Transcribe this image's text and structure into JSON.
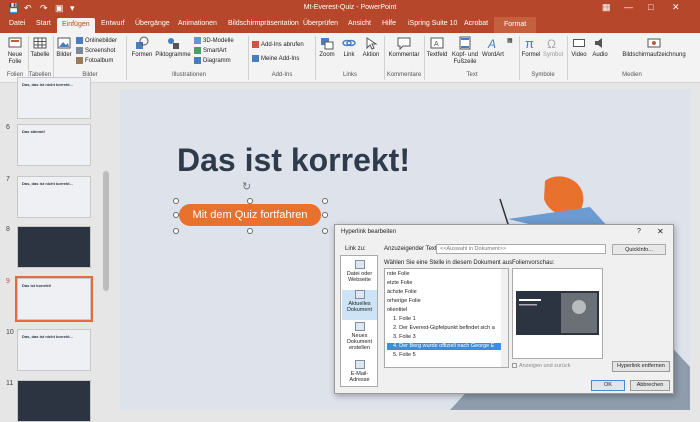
{
  "window": {
    "title": "Mt-Everest-Quiz  -  PowerPoint"
  },
  "quick_access": {
    "save": "save-icon",
    "undo": "undo-icon",
    "redo": "redo-icon",
    "present": "present-icon",
    "customize": "customize-icon"
  },
  "tabs": [
    "Datei",
    "Start",
    "Einfügen",
    "Entwurf",
    "Übergänge",
    "Animationen",
    "Bildschirmpräsentation",
    "Überprüfen",
    "Ansicht",
    "Hilfe",
    "iSpring Suite 10",
    "Acrobat",
    "Format"
  ],
  "active_tab": "Einfügen",
  "ribbon": {
    "folien": {
      "new_slide": "Neue Folie",
      "group": "Folien"
    },
    "tabellen": {
      "table": "Tabelle",
      "group": "Tabellen"
    },
    "bilder": {
      "images": "Bilder",
      "online": "Onlinebilder",
      "screenshot": "Screenshot",
      "album": "Fotoalbum",
      "group": "Bilder"
    },
    "illustrationen": {
      "shapes": "Formen",
      "pictograms": "Piktogramme",
      "models3d": "3D-Modelle",
      "smartart": "SmartArt",
      "diagram": "Diagramm",
      "group": "Illustrationen"
    },
    "addins": {
      "get": "Add-Ins abrufen",
      "mine": "Meine Add-Ins",
      "group": "Add-Ins"
    },
    "links": {
      "zoom": "Zoom",
      "link": "Link",
      "action": "Aktion",
      "group": "Links"
    },
    "kommentare": {
      "comment": "Kommentar",
      "group": "Kommentare"
    },
    "text": {
      "textbox": "Textfeld",
      "header": "Kopf- und Fußzeile",
      "wordart": "WordArt",
      "group": "Text"
    },
    "symbole": {
      "formula": "Formel",
      "symbol": "Symbol",
      "group": "Symbole"
    },
    "medien": {
      "video": "Video",
      "audio": "Audio",
      "record": "Bildschirmaufzeichnung",
      "group": "Medien"
    }
  },
  "thumbnails": [
    {
      "num": "",
      "title": "Das, das ist nicht korrekt...",
      "dark": false
    },
    {
      "num": "6",
      "title": "Das stimmt!",
      "dark": false
    },
    {
      "num": "7",
      "title": "Das, das ist nicht korrekt...",
      "dark": false
    },
    {
      "num": "8",
      "title": "",
      "dark": true
    },
    {
      "num": "9",
      "title": "Das ist korrekt!",
      "dark": false
    },
    {
      "num": "10",
      "title": "Das, das ist nicht korrekt...",
      "dark": false
    },
    {
      "num": "11",
      "title": "",
      "dark": true
    }
  ],
  "slide": {
    "heading": "Das ist korrekt!",
    "button": "Mit dem Quiz fortfahren"
  },
  "dialog": {
    "title": "Hyperlink bearbeiten",
    "help": "?",
    "link_to_label": "Link zu:",
    "display_text_label": "Anzuzeigender Text:",
    "display_text_value": "<<Auswahl in Dokument>>",
    "screentip_button": "QuickInfo...",
    "link_options": [
      "Datei oder Webseite",
      "Aktuelles Dokument",
      "Neues Dokument erstellen",
      "E-Mail-Adresse"
    ],
    "choose_label": "Wählen Sie eine Stelle in diesem Dokument aus:",
    "doc_items": [
      "rste Folie",
      "etzte Folie",
      "ächste Folie",
      "orherige Folie",
      "olientitel",
      "1. Folie 1",
      "2. Der Everest-Gipfelpunkt befindet sich a",
      "3. Folie 3",
      "4. Der Berg wurde offiziell nach George E",
      "5. Folie 5"
    ],
    "selected_item": "4. Der Berg wurde offiziell nach George E",
    "preview_label": "Folienvorschau:",
    "show_return": "Anzeigen und zurück",
    "remove_link": "Hyperlink entfernen",
    "ok": "OK",
    "cancel": "Abbrechen"
  }
}
